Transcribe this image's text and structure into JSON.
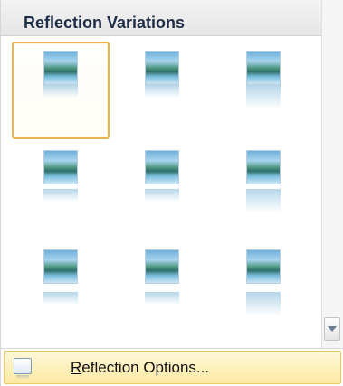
{
  "gallery": {
    "title": "Reflection Variations",
    "selected_index": 0,
    "items": [
      {
        "reflection": "tight-half"
      },
      {
        "reflection": "tight-half"
      },
      {
        "reflection": "tight-full"
      },
      {
        "reflection": "gap-half"
      },
      {
        "reflection": "gap-half"
      },
      {
        "reflection": "gap-full"
      },
      {
        "reflection": "gapl-half"
      },
      {
        "reflection": "gapl-half"
      },
      {
        "reflection": "gapl-full"
      }
    ]
  },
  "scrollbar": {
    "down_icon": "chevron-down-icon"
  },
  "options": {
    "accesskey": "R",
    "label_rest": "eflection Options...",
    "icon": "reflection-options-icon"
  },
  "colors": {
    "selection_border": "#e9b44f",
    "hover_background": "#fde9a3",
    "header_text": "#1f2d46"
  }
}
